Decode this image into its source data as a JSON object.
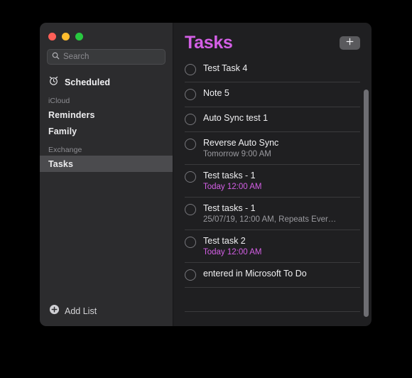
{
  "window": {
    "traffic_lights": [
      {
        "name": "close",
        "color": "#ff5f57"
      },
      {
        "name": "minimize",
        "color": "#febc2e"
      },
      {
        "name": "maximize",
        "color": "#28c840"
      }
    ]
  },
  "sidebar": {
    "search": {
      "placeholder": "Search",
      "value": "",
      "icon": "search-icon"
    },
    "smart_lists": [
      {
        "label": "Scheduled",
        "icon": "alarm-clock-icon"
      }
    ],
    "sections": [
      {
        "header": "iCloud",
        "items": [
          {
            "label": "Reminders",
            "selected": false
          },
          {
            "label": "Family",
            "selected": false
          }
        ]
      },
      {
        "header": "Exchange",
        "items": [
          {
            "label": "Tasks",
            "selected": true
          }
        ]
      }
    ],
    "add_list": {
      "label": "Add List",
      "icon": "plus-circle-icon"
    }
  },
  "main": {
    "title": "Tasks",
    "title_color": "#d45fe6",
    "add_button_icon": "plus-icon",
    "tasks": [
      {
        "title": "Test Task 4",
        "subtitle": "",
        "due_accent": false
      },
      {
        "title": "Note 5",
        "subtitle": "",
        "due_accent": false
      },
      {
        "title": "Auto Sync test 1",
        "subtitle": "",
        "due_accent": false
      },
      {
        "title": "Reverse Auto Sync",
        "subtitle": "Tomorrow 9:00 AM",
        "due_accent": false
      },
      {
        "title": "Test tasks - 1",
        "subtitle": "Today 12:00 AM",
        "due_accent": true
      },
      {
        "title": "Test tasks - 1",
        "subtitle": "25/07/19, 12:00 AM, Repeats Ever…",
        "due_accent": false
      },
      {
        "title": "Test task 2",
        "subtitle": "Today 12:00 AM",
        "due_accent": true
      },
      {
        "title": "entered in Microsoft To Do",
        "subtitle": "",
        "due_accent": false
      },
      {
        "title": "",
        "subtitle": "",
        "due_accent": false
      },
      {
        "title": "",
        "subtitle": "",
        "due_accent": false
      }
    ]
  }
}
